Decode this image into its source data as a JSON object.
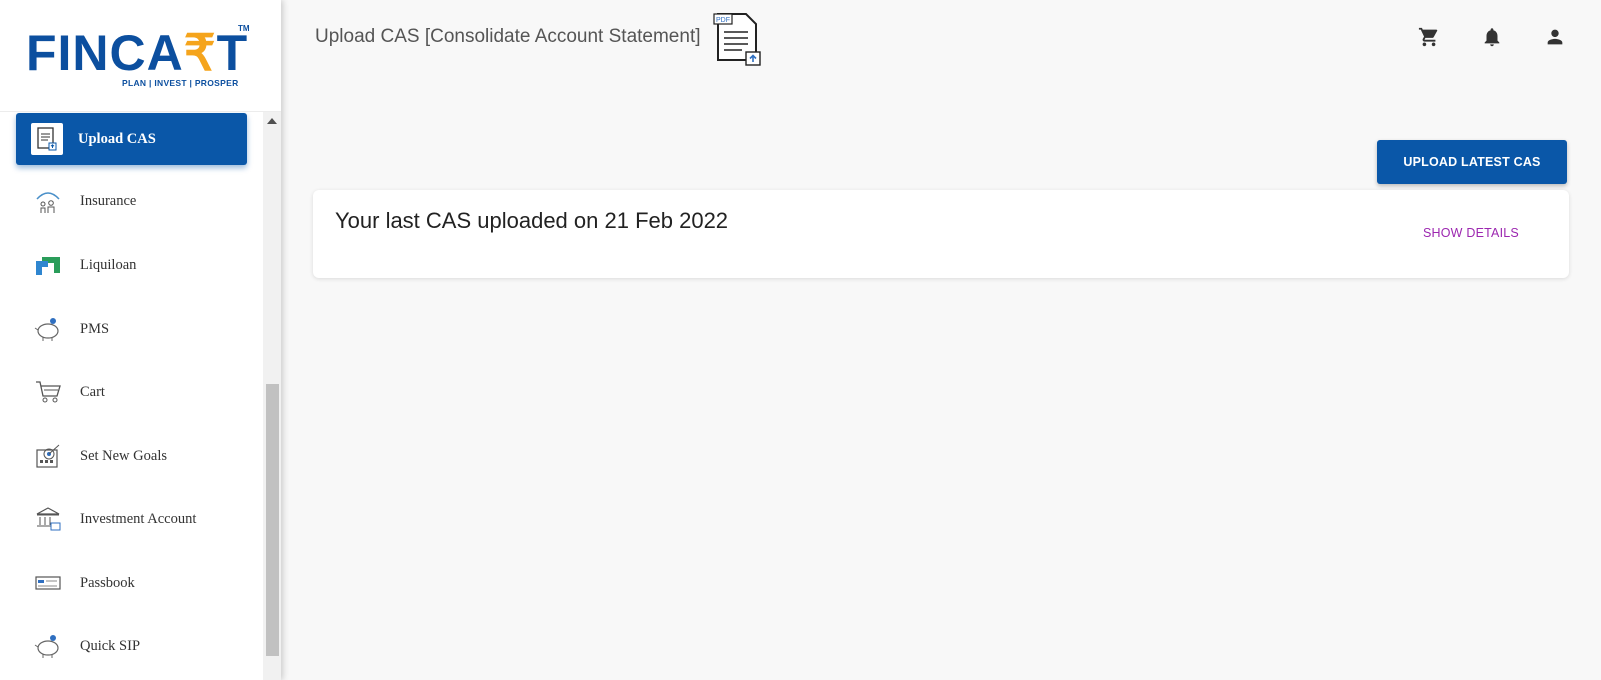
{
  "logo": {
    "text_main": "FINCA",
    "text_rupee": "₹",
    "text_end": "T",
    "tm": "TM",
    "tagline": "PLAN | INVEST | PROSPER"
  },
  "sidebar": {
    "items": [
      {
        "label": "Upload CAS",
        "icon": "upload-document-icon",
        "active": true
      },
      {
        "label": "Insurance",
        "icon": "umbrella-family-icon"
      },
      {
        "label": "Liquiloan",
        "icon": "liquiloan-logo-icon"
      },
      {
        "label": "PMS",
        "icon": "piggy-bank-icon"
      },
      {
        "label": "Cart",
        "icon": "cart-icon"
      },
      {
        "label": "Set New Goals",
        "icon": "goal-target-icon"
      },
      {
        "label": "Investment Account",
        "icon": "bank-icon"
      },
      {
        "label": "Passbook",
        "icon": "passbook-icon"
      },
      {
        "label": "Quick SIP",
        "icon": "piggy-bank-icon"
      }
    ]
  },
  "header": {
    "title": "Upload CAS [Consolidate Account Statement]",
    "doc_icon_badge": "PDF"
  },
  "main": {
    "upload_button": "UPLOAD LATEST CAS",
    "card_text": "Your last CAS uploaded on 21 Feb 2022",
    "show_details": "SHOW DETAILS"
  },
  "colors": {
    "primary": "#0a57a8",
    "brand_blue": "#0c4f9f",
    "brand_orange": "#f5a41c",
    "link_purple": "#9c27b0"
  }
}
